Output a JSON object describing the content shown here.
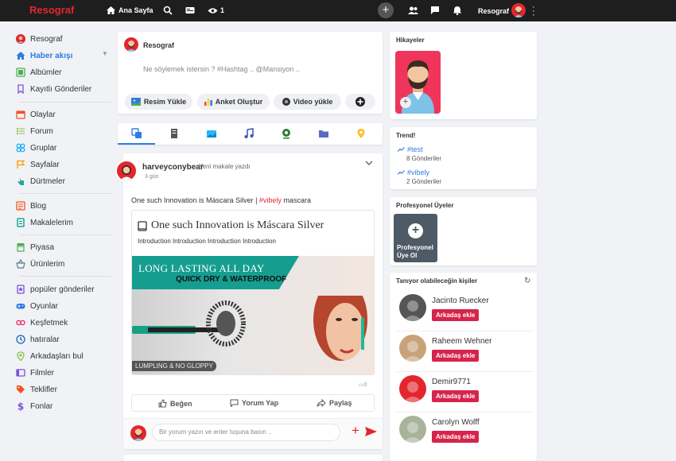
{
  "brand": {
    "name": "Resograf",
    "color": "#e3262e"
  },
  "topbar": {
    "home_label": "Ana Sayfa",
    "views_count": "1",
    "user_name": "Resograf"
  },
  "sidebar": {
    "items": [
      {
        "label": "Resograf",
        "icon": "user-avatar-icon",
        "color": "#e3262e"
      },
      {
        "label": "Haber akışı",
        "icon": "home-icon",
        "color": "#2f7be5",
        "active": true
      },
      {
        "label": "Albümler",
        "icon": "album-icon",
        "color": "#4caf50"
      },
      {
        "label": "Kayıtlı Gönderiler",
        "icon": "bookmark-icon",
        "color": "#7b4fe0"
      },
      {
        "label": "Olaylar",
        "icon": "calendar-icon",
        "color": "#f4511e"
      },
      {
        "label": "Forum",
        "icon": "list-icon",
        "color": "#8bc34a"
      },
      {
        "label": "Gruplar",
        "icon": "groups-icon",
        "color": "#03a9f4"
      },
      {
        "label": "Sayfalar",
        "icon": "flag-icon",
        "color": "#ff9800"
      },
      {
        "label": "Dürtmeler",
        "icon": "poke-icon",
        "color": "#26a69a"
      },
      {
        "label": "Blog",
        "icon": "blog-icon",
        "color": "#f4511e"
      },
      {
        "label": "Makalelerim",
        "icon": "article-icon",
        "color": "#009688"
      },
      {
        "label": "Piyasa",
        "icon": "store-icon",
        "color": "#4caf50"
      },
      {
        "label": "Ürünlerim",
        "icon": "basket-icon",
        "color": "#607d8b"
      },
      {
        "label": "popüler gönderiler",
        "icon": "popular-icon",
        "color": "#7b4fe0"
      },
      {
        "label": "Oyunlar",
        "icon": "gamepad-icon",
        "color": "#2f7be5"
      },
      {
        "label": "Keşfetmek",
        "icon": "explore-icon",
        "color": "#e91e63"
      },
      {
        "label": "hatıralar",
        "icon": "memories-icon",
        "color": "#1565c0"
      },
      {
        "label": "Arkadaşları bul",
        "icon": "find-friends-icon",
        "color": "#8bc34a"
      },
      {
        "label": "Filmler",
        "icon": "film-icon",
        "color": "#7b4fe0"
      },
      {
        "label": "Teklifler",
        "icon": "offer-icon",
        "color": "#f4511e"
      },
      {
        "label": "Fonlar",
        "icon": "dollar-icon",
        "color": "#7b4fe0"
      }
    ]
  },
  "composer": {
    "user_name": "Resograf",
    "placeholder": "Ne söylemek istersin ? #Hashtag .. @Mansiyon ..",
    "buttons": [
      "Resim Yükle",
      "Anket Oluştur",
      "Video yükle"
    ]
  },
  "post": {
    "author": "harveyconybear",
    "action": "Yeni makale yazdı",
    "time": "3 gün",
    "text_prefix": "One such Innovation is Máscara Silver | ",
    "text_tag": "#vibely",
    "text_suffix": " mascara",
    "article_title": "One such Innovation is Máscara Silver",
    "article_sub": "Introduction Introduction Introduction Introduction",
    "banner_line1": "LONG LASTING ALL DAY",
    "banner_line2": "QUICK DRY & WATERPROOF",
    "banner_tag": "LUMPLING & NO GLOPPY",
    "reaction_count": "0",
    "like_label": "Beğen",
    "comment_label": "Yorum Yap",
    "share_label": "Paylaş",
    "comment_placeholder": "Bir yorum yazın ve enter tuşuna basın .."
  },
  "right": {
    "stories_title": "Hikayeler",
    "trend_title": "Trend!",
    "trends": [
      {
        "tag": "#test",
        "count": "8 Gönderiler"
      },
      {
        "tag": "#vibely",
        "count": "2 Gönderiler"
      }
    ],
    "pro_title": "Profesyonel Üyeler",
    "pro_label": "Profesyonel Üye Ol",
    "people_title": "Tanıyor olabileceğin kişiler",
    "add_friend_label": "Arkadaş ekle",
    "people": [
      {
        "name": "Jacinto Ruecker",
        "color": "#555555"
      },
      {
        "name": "Raheem Wehner",
        "color": "#c9a27a"
      },
      {
        "name": "Demir9771",
        "color": "#e3262e"
      },
      {
        "name": "Carolyn Wolff",
        "color": "#a8b39a"
      }
    ]
  }
}
